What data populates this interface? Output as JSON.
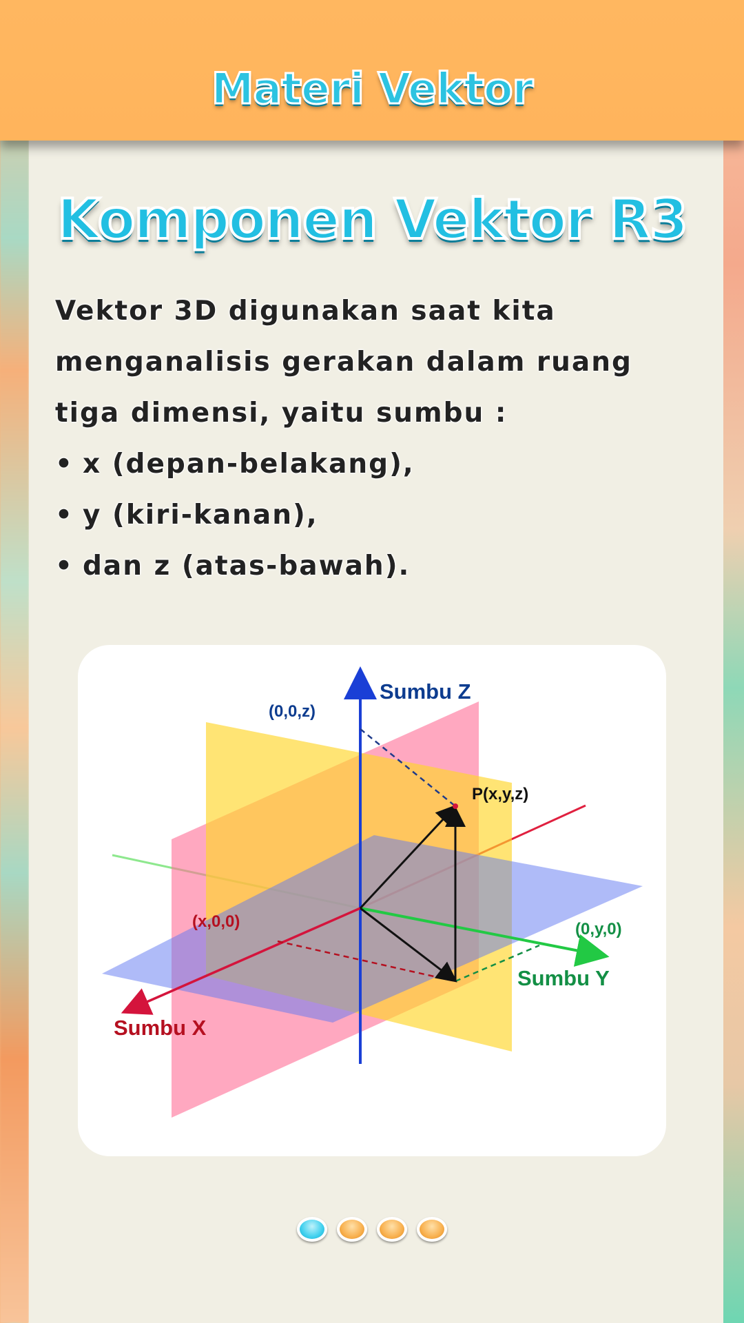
{
  "app": {
    "title": "Materi Vektor"
  },
  "slide": {
    "title": "Komponen Vektor R3",
    "intro_lines": [
      "Vektor 3D digunakan saat kita",
      "menganalisis gerakan dalam ruang",
      "tiga dimensi, yaitu sumbu :"
    ],
    "bullets": [
      "x (depan-belakang),",
      "y (kiri-kanan),",
      "dan z (atas-bawah)."
    ],
    "bullet_symbol": "•"
  },
  "figure": {
    "label_z_axis": "Sumbu Z",
    "label_x_axis": "Sumbu X",
    "label_y_axis": "Sumbu Y",
    "label_point": "P(x,y,z)",
    "label_z_proj": "(0,0,z)",
    "label_x_proj": "(x,0,0)",
    "label_y_proj": "(0,y,0)",
    "colors": {
      "z_axis": "#1a3fd6",
      "z_text": "#0d3c8f",
      "x_axis": "#d4143c",
      "x_text": "#b51020",
      "y_axis": "#22c944",
      "y_text": "#138f45"
    }
  },
  "pager": {
    "total": 4,
    "active_index": 0,
    "active_color": "#3fd0ee",
    "inactive_color": "#f8b04e"
  }
}
